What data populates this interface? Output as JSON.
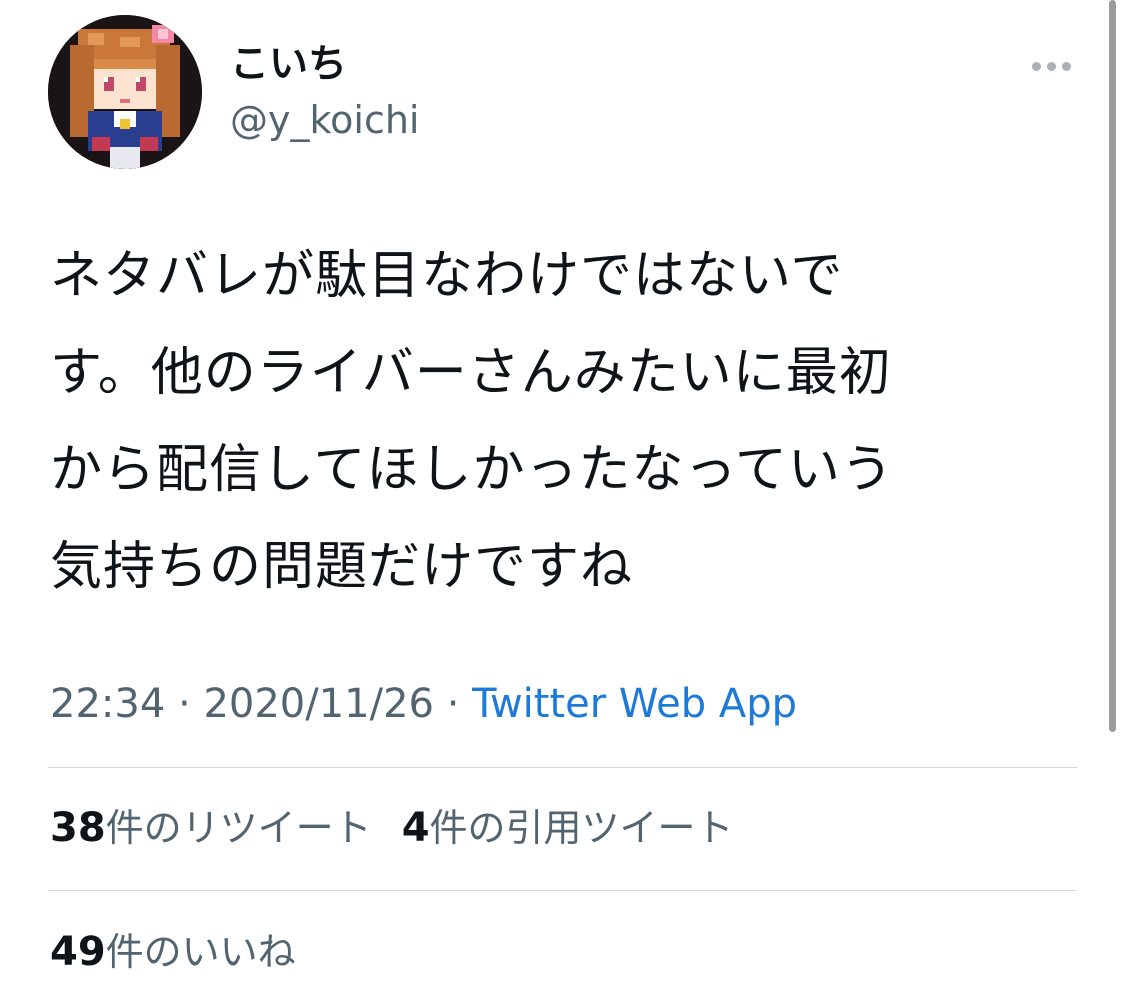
{
  "author": {
    "display_name": "こいち",
    "handle": "@y_koichi",
    "avatar_icon": "pixel-art-avatar-icon"
  },
  "more_icon": "more-horizontal-icon",
  "tweet": {
    "text": "ネタバレが駄目なわけではないで\nす。他のライバーさんみたいに最初\nから配信してほしかったなっていう\n気持ちの問題だけですね",
    "time": "22:34",
    "separator": "·",
    "date": "2020/11/26",
    "source": "Twitter Web App"
  },
  "stats": {
    "retweets": {
      "count": "38",
      "label": "件のリツイート"
    },
    "quotes": {
      "count": "4",
      "label": "件の引用ツイート"
    },
    "likes": {
      "count": "49",
      "label": "件のいいね"
    }
  },
  "colors": {
    "text": "#0f1419",
    "secondary": "#536471",
    "link": "#1d7ad8",
    "divider": "#d3d8dc"
  }
}
